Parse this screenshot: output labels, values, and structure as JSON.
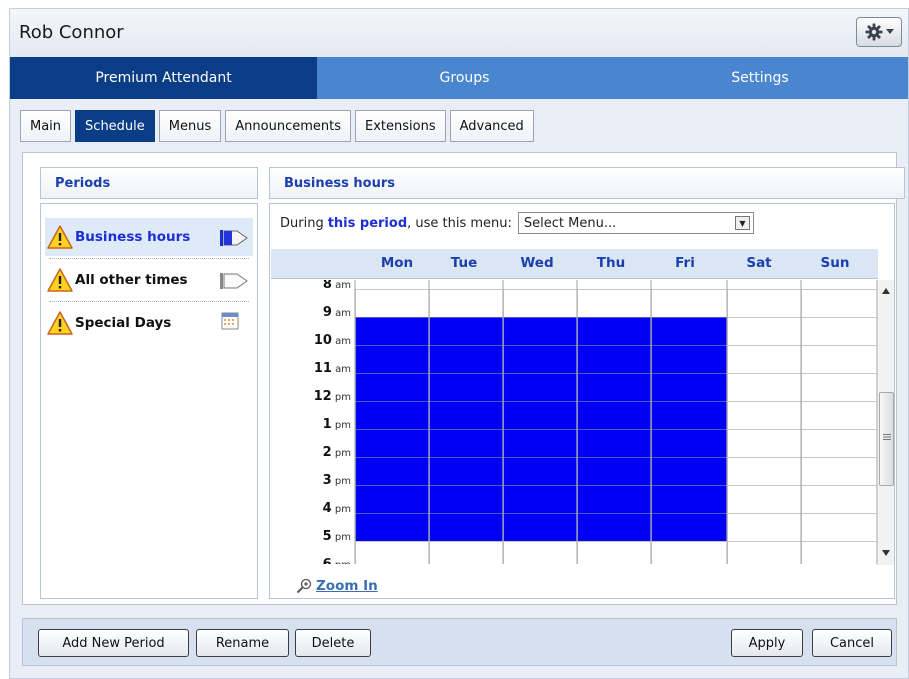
{
  "window": {
    "title": "Rob Connor"
  },
  "top_nav": [
    {
      "label": "Premium Attendant",
      "active": true
    },
    {
      "label": "Groups",
      "active": false
    },
    {
      "label": "Settings",
      "active": false
    }
  ],
  "sub_tabs": [
    {
      "label": "Main",
      "active": false
    },
    {
      "label": "Schedule",
      "active": true
    },
    {
      "label": "Menus",
      "active": false
    },
    {
      "label": "Announcements",
      "active": false
    },
    {
      "label": "Extensions",
      "active": false
    },
    {
      "label": "Advanced",
      "active": false
    }
  ],
  "periods": {
    "heading": "Periods",
    "items": [
      {
        "label": "Business hours",
        "icon": "blue-flag-icon",
        "active": true
      },
      {
        "label": "All other times",
        "icon": "white-flag-icon",
        "active": false
      },
      {
        "label": "Special Days",
        "icon": "calendar-icon",
        "active": false
      }
    ]
  },
  "schedule": {
    "heading": "Business hours",
    "during_prefix": "During",
    "during_highlight": "this period",
    "during_suffix": ", use this menu:",
    "menu_select": {
      "value": "Select Menu..."
    },
    "days": [
      "Mon",
      "Tue",
      "Wed",
      "Thu",
      "Fri",
      "Sat",
      "Sun"
    ],
    "hours": [
      {
        "num": "8",
        "ampm": "am"
      },
      {
        "num": "9",
        "ampm": "am"
      },
      {
        "num": "10",
        "ampm": "am"
      },
      {
        "num": "11",
        "ampm": "am"
      },
      {
        "num": "12",
        "ampm": "pm"
      },
      {
        "num": "1",
        "ampm": "pm"
      },
      {
        "num": "2",
        "ampm": "pm"
      },
      {
        "num": "3",
        "ampm": "pm"
      },
      {
        "num": "4",
        "ampm": "pm"
      },
      {
        "num": "5",
        "ampm": "pm"
      },
      {
        "num": "6",
        "ampm": "pm"
      }
    ],
    "active_days": [
      "Mon",
      "Tue",
      "Wed",
      "Thu",
      "Fri"
    ],
    "active_hours": [
      "9 am",
      "10 am",
      "11 am",
      "12 pm",
      "1 pm",
      "2 pm",
      "3 pm",
      "4 pm"
    ],
    "zoom_label": "Zoom In",
    "colors": {
      "active": "#0000f5",
      "header_bg": "#dbe6f5",
      "heading_text": "#1c3fae"
    }
  },
  "buttons": {
    "add_new_period": "Add New Period",
    "rename": "Rename",
    "delete": "Delete",
    "apply": "Apply",
    "cancel": "Cancel"
  }
}
